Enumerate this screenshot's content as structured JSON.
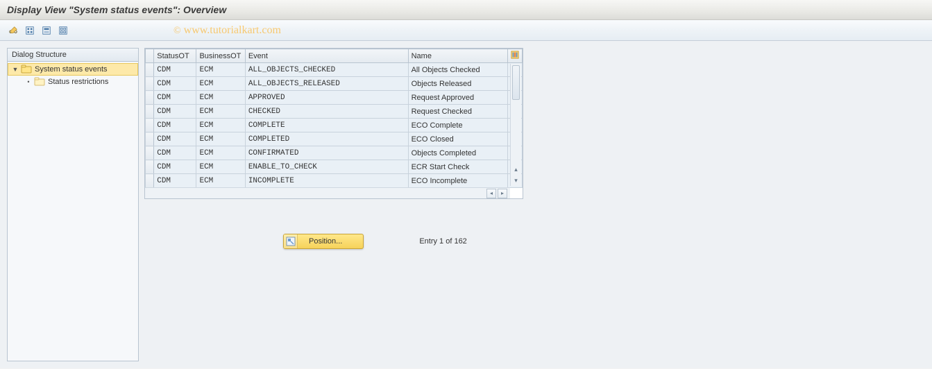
{
  "title": "Display View \"System status events\": Overview",
  "watermark": "www.tutorialkart.com",
  "tree": {
    "header": "Dialog Structure",
    "items": [
      {
        "label": "System status events",
        "selected": true,
        "open": true
      },
      {
        "label": "Status restrictions",
        "selected": false,
        "open": false
      }
    ]
  },
  "table": {
    "columns": [
      "StatusOT",
      "BusinessOT",
      "Event",
      "Name"
    ],
    "rows": [
      {
        "status": "CDM",
        "business": "ECM",
        "event": "ALL_OBJECTS_CHECKED",
        "name": "All Objects Checked"
      },
      {
        "status": "CDM",
        "business": "ECM",
        "event": "ALL_OBJECTS_RELEASED",
        "name": "Objects Released"
      },
      {
        "status": "CDM",
        "business": "ECM",
        "event": "APPROVED",
        "name": "Request Approved"
      },
      {
        "status": "CDM",
        "business": "ECM",
        "event": "CHECKED",
        "name": "Request Checked"
      },
      {
        "status": "CDM",
        "business": "ECM",
        "event": "COMPLETE",
        "name": "ECO Complete"
      },
      {
        "status": "CDM",
        "business": "ECM",
        "event": "COMPLETED",
        "name": "ECO Closed"
      },
      {
        "status": "CDM",
        "business": "ECM",
        "event": "CONFIRMATED",
        "name": "Objects Completed"
      },
      {
        "status": "CDM",
        "business": "ECM",
        "event": "ENABLE_TO_CHECK",
        "name": "ECR Start Check"
      },
      {
        "status": "CDM",
        "business": "ECM",
        "event": "INCOMPLETE",
        "name": "ECO Incomplete"
      }
    ]
  },
  "position_button": "Position...",
  "entry_text": "Entry 1 of 162"
}
